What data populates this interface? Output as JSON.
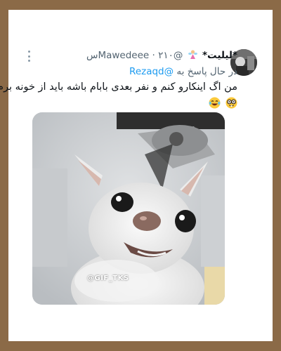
{
  "tweet": {
    "author_name": "*لیلیت*",
    "handle": "@Mawedeee",
    "time": "۲۱۰س",
    "separator": "·",
    "reply_prefix": "در حال پاسخ به",
    "reply_to": "@Rezaqd",
    "text": "من اگ اینکارو کنم و نفر بعدی بابام باشه باید از خونه برم",
    "emojis": [
      "nerd-face-emoji",
      "laughing-tears-emoji"
    ],
    "name_emoji": "fairy-emoji"
  },
  "media": {
    "watermark": "@GIF_TKS",
    "description_icon": "chihuahua-gif"
  },
  "colors": {
    "frame": "#8b6a47",
    "card": "#ffffff",
    "link": "#1d9bf0",
    "muted": "#536471"
  }
}
